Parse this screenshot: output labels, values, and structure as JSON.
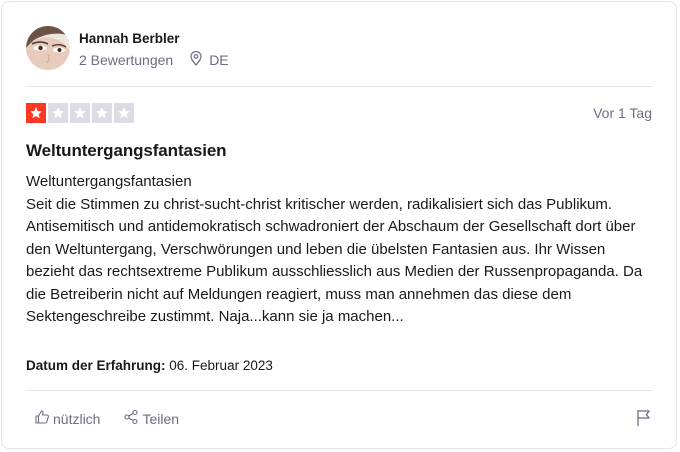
{
  "reviewer": {
    "name": "Hannah Berbler",
    "review_count": "2 Bewertungen",
    "country": "DE"
  },
  "review": {
    "rating": 1,
    "rating_max": 5,
    "time_ago": "Vor 1 Tag",
    "title": "Weltuntergangsfantasien",
    "body_heading": "Weltuntergangsfantasien",
    "body": "Seit die Stimmen zu christ-sucht-christ kritischer werden, radikalisiert sich das Publikum. Antisemitisch und antidemokratisch schwadroniert der Abschaum der Gesellschaft dort über den Weltuntergang, Verschwörungen und leben die übelsten Fantasien aus. Ihr Wissen bezieht das rechtsextreme Publikum ausschliesslich aus Medien der Russenpropaganda. Da die Betreiberin nicht auf Meldungen reagiert, muss man annehmen das diese dem Sektengeschreibe zustimmt. Naja...kann sie ja machen...",
    "experience_label": "Datum der Erfahrung:",
    "experience_date": "06. Februar 2023"
  },
  "actions": {
    "useful_label": "nützlich",
    "share_label": "Teilen"
  },
  "colors": {
    "star_filled": "#ff3722",
    "star_empty": "#dcdce6",
    "muted_text": "#6c6c85",
    "divider": "#e5e5dd"
  },
  "icons": [
    "location-pin-icon",
    "star-icon",
    "thumbs-up-icon",
    "share-icon",
    "flag-icon"
  ]
}
